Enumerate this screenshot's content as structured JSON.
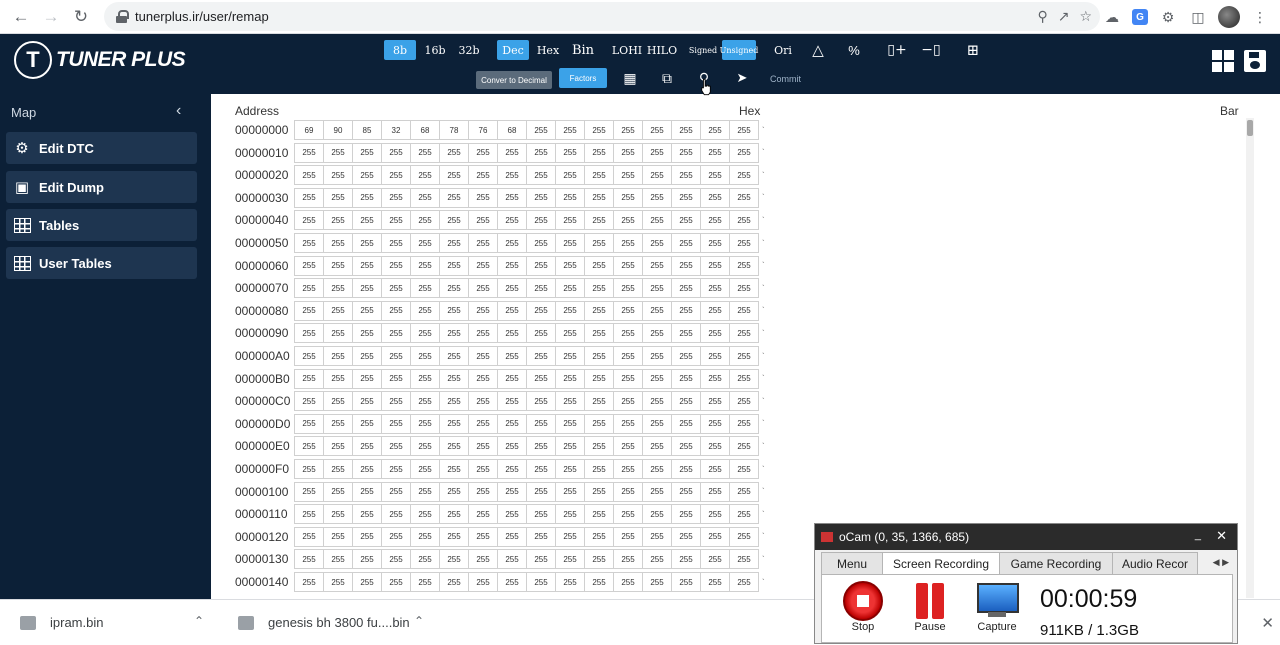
{
  "browser": {
    "url": "tunerplus.ir/user/remap"
  },
  "app": {
    "logo_text": "TUNER PLUS"
  },
  "toolbar": {
    "row1": [
      {
        "label": "8b",
        "active": true
      },
      {
        "label": "16b",
        "active": false
      },
      {
        "label": "32b",
        "active": false
      },
      {
        "label": "Dec",
        "active": true
      },
      {
        "label": "Hex",
        "active": false
      },
      {
        "label": "Bin",
        "active": false
      },
      {
        "label": "LOHI",
        "active": false
      },
      {
        "label": "HILO",
        "active": false
      },
      {
        "label": "Signed",
        "active": false
      },
      {
        "label": "Unsigned",
        "active": true
      },
      {
        "label": "Ori",
        "active": false
      }
    ],
    "tooltip": "Conver to Decimal",
    "factors_label": "Factors",
    "commit_label": "Commit"
  },
  "sidebar": {
    "title": "Map",
    "items": [
      {
        "label": "Edit DTC",
        "icon": "engine-icon"
      },
      {
        "label": "Edit Dump",
        "icon": "chip-icon"
      },
      {
        "label": "Tables",
        "icon": "table-icon"
      },
      {
        "label": "User Tables",
        "icon": "table-icon"
      }
    ]
  },
  "hexview": {
    "headers": {
      "address": "Address",
      "hex": "Hex",
      "bar": "Bar"
    },
    "rows": [
      {
        "address": "00000000",
        "values": [
          "69",
          "90",
          "85",
          "32",
          "68",
          "78",
          "76",
          "68",
          "255",
          "255",
          "255",
          "255",
          "255",
          "255",
          "255",
          "255"
        ]
      },
      {
        "address": "00000010",
        "values": [
          "255",
          "255",
          "255",
          "255",
          "255",
          "255",
          "255",
          "255",
          "255",
          "255",
          "255",
          "255",
          "255",
          "255",
          "255",
          "255"
        ]
      },
      {
        "address": "00000020",
        "values": [
          "255",
          "255",
          "255",
          "255",
          "255",
          "255",
          "255",
          "255",
          "255",
          "255",
          "255",
          "255",
          "255",
          "255",
          "255",
          "255"
        ]
      },
      {
        "address": "00000030",
        "values": [
          "255",
          "255",
          "255",
          "255",
          "255",
          "255",
          "255",
          "255",
          "255",
          "255",
          "255",
          "255",
          "255",
          "255",
          "255",
          "255"
        ]
      },
      {
        "address": "00000040",
        "values": [
          "255",
          "255",
          "255",
          "255",
          "255",
          "255",
          "255",
          "255",
          "255",
          "255",
          "255",
          "255",
          "255",
          "255",
          "255",
          "255"
        ]
      },
      {
        "address": "00000050",
        "values": [
          "255",
          "255",
          "255",
          "255",
          "255",
          "255",
          "255",
          "255",
          "255",
          "255",
          "255",
          "255",
          "255",
          "255",
          "255",
          "255"
        ]
      },
      {
        "address": "00000060",
        "values": [
          "255",
          "255",
          "255",
          "255",
          "255",
          "255",
          "255",
          "255",
          "255",
          "255",
          "255",
          "255",
          "255",
          "255",
          "255",
          "255"
        ]
      },
      {
        "address": "00000070",
        "values": [
          "255",
          "255",
          "255",
          "255",
          "255",
          "255",
          "255",
          "255",
          "255",
          "255",
          "255",
          "255",
          "255",
          "255",
          "255",
          "255"
        ]
      },
      {
        "address": "00000080",
        "values": [
          "255",
          "255",
          "255",
          "255",
          "255",
          "255",
          "255",
          "255",
          "255",
          "255",
          "255",
          "255",
          "255",
          "255",
          "255",
          "255"
        ]
      },
      {
        "address": "00000090",
        "values": [
          "255",
          "255",
          "255",
          "255",
          "255",
          "255",
          "255",
          "255",
          "255",
          "255",
          "255",
          "255",
          "255",
          "255",
          "255",
          "255"
        ]
      },
      {
        "address": "000000A0",
        "values": [
          "255",
          "255",
          "255",
          "255",
          "255",
          "255",
          "255",
          "255",
          "255",
          "255",
          "255",
          "255",
          "255",
          "255",
          "255",
          "255"
        ]
      },
      {
        "address": "000000B0",
        "values": [
          "255",
          "255",
          "255",
          "255",
          "255",
          "255",
          "255",
          "255",
          "255",
          "255",
          "255",
          "255",
          "255",
          "255",
          "255",
          "255"
        ]
      },
      {
        "address": "000000C0",
        "values": [
          "255",
          "255",
          "255",
          "255",
          "255",
          "255",
          "255",
          "255",
          "255",
          "255",
          "255",
          "255",
          "255",
          "255",
          "255",
          "255"
        ]
      },
      {
        "address": "000000D0",
        "values": [
          "255",
          "255",
          "255",
          "255",
          "255",
          "255",
          "255",
          "255",
          "255",
          "255",
          "255",
          "255",
          "255",
          "255",
          "255",
          "255"
        ]
      },
      {
        "address": "000000E0",
        "values": [
          "255",
          "255",
          "255",
          "255",
          "255",
          "255",
          "255",
          "255",
          "255",
          "255",
          "255",
          "255",
          "255",
          "255",
          "255",
          "255"
        ]
      },
      {
        "address": "000000F0",
        "values": [
          "255",
          "255",
          "255",
          "255",
          "255",
          "255",
          "255",
          "255",
          "255",
          "255",
          "255",
          "255",
          "255",
          "255",
          "255",
          "255"
        ]
      },
      {
        "address": "00000100",
        "values": [
          "255",
          "255",
          "255",
          "255",
          "255",
          "255",
          "255",
          "255",
          "255",
          "255",
          "255",
          "255",
          "255",
          "255",
          "255",
          "255"
        ]
      },
      {
        "address": "00000110",
        "values": [
          "255",
          "255",
          "255",
          "255",
          "255",
          "255",
          "255",
          "255",
          "255",
          "255",
          "255",
          "255",
          "255",
          "255",
          "255",
          "255"
        ]
      },
      {
        "address": "00000120",
        "values": [
          "255",
          "255",
          "255",
          "255",
          "255",
          "255",
          "255",
          "255",
          "255",
          "255",
          "255",
          "255",
          "255",
          "255",
          "255",
          "255"
        ]
      },
      {
        "address": "00000130",
        "values": [
          "255",
          "255",
          "255",
          "255",
          "255",
          "255",
          "255",
          "255",
          "255",
          "255",
          "255",
          "255",
          "255",
          "255",
          "255",
          "255"
        ]
      },
      {
        "address": "00000140",
        "values": [
          "255",
          "255",
          "255",
          "255",
          "255",
          "255",
          "255",
          "255",
          "255",
          "255",
          "255",
          "255",
          "255",
          "255",
          "255",
          "255"
        ]
      }
    ]
  },
  "downloads": [
    {
      "name": "ipram.bin"
    },
    {
      "name": "genesis bh 3800 fu....bin"
    }
  ],
  "ocam": {
    "title": "oCam (0, 35, 1366, 685)",
    "tabs": [
      "Menu",
      "Screen Recording",
      "Game Recording",
      "Audio Recor"
    ],
    "stop_label": "Stop",
    "pause_label": "Pause",
    "capture_label": "Capture",
    "time": "00:00:59",
    "size": "911KB / 1.3GB"
  },
  "colors": {
    "header_bg": "#0c2037",
    "accent": "#3ba2e8",
    "sidebar_item_bg": "#1e3550"
  }
}
